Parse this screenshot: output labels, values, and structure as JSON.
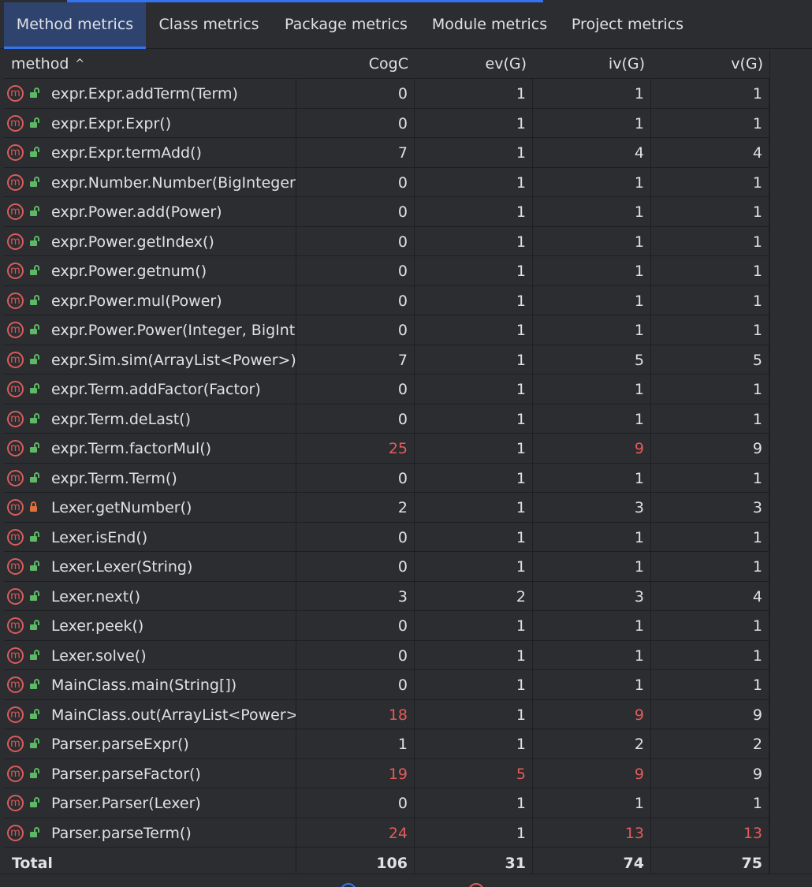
{
  "tabs": [
    {
      "label": "Method metrics",
      "active": true
    },
    {
      "label": "Class metrics",
      "active": false
    },
    {
      "label": "Package metrics",
      "active": false
    },
    {
      "label": "Module metrics",
      "active": false
    },
    {
      "label": "Project metrics",
      "active": false
    }
  ],
  "table": {
    "columns": {
      "method": "method",
      "cogc": "CogC",
      "ev": "ev(G)",
      "iv": "iv(G)",
      "v": "v(G)"
    },
    "sort_glyph": "^",
    "rows": [
      {
        "method": "expr.Expr.addTerm(Term)",
        "access": "public",
        "cogc": "0",
        "ev": "1",
        "iv": "1",
        "v": "1"
      },
      {
        "method": "expr.Expr.Expr()",
        "access": "public",
        "cogc": "0",
        "ev": "1",
        "iv": "1",
        "v": "1"
      },
      {
        "method": "expr.Expr.termAdd()",
        "access": "public",
        "cogc": "7",
        "ev": "1",
        "iv": "4",
        "v": "4"
      },
      {
        "method": "expr.Number.Number(BigInteger)",
        "access": "public",
        "cogc": "0",
        "ev": "1",
        "iv": "1",
        "v": "1"
      },
      {
        "method": "expr.Power.add(Power)",
        "access": "public",
        "cogc": "0",
        "ev": "1",
        "iv": "1",
        "v": "1"
      },
      {
        "method": "expr.Power.getIndex()",
        "access": "public",
        "cogc": "0",
        "ev": "1",
        "iv": "1",
        "v": "1"
      },
      {
        "method": "expr.Power.getnum()",
        "access": "public",
        "cogc": "0",
        "ev": "1",
        "iv": "1",
        "v": "1"
      },
      {
        "method": "expr.Power.mul(Power)",
        "access": "public",
        "cogc": "0",
        "ev": "1",
        "iv": "1",
        "v": "1"
      },
      {
        "method": "expr.Power.Power(Integer, BigInteger)",
        "access": "public",
        "cogc": "0",
        "ev": "1",
        "iv": "1",
        "v": "1"
      },
      {
        "method": "expr.Sim.sim(ArrayList<Power>)",
        "access": "public",
        "cogc": "7",
        "ev": "1",
        "iv": "5",
        "v": "5"
      },
      {
        "method": "expr.Term.addFactor(Factor)",
        "access": "public",
        "cogc": "0",
        "ev": "1",
        "iv": "1",
        "v": "1"
      },
      {
        "method": "expr.Term.deLast()",
        "access": "public",
        "cogc": "0",
        "ev": "1",
        "iv": "1",
        "v": "1"
      },
      {
        "method": "expr.Term.factorMul()",
        "access": "public",
        "cogc": "25",
        "ev": "1",
        "iv": "9",
        "v": "9",
        "warn": [
          "cogc",
          "iv"
        ]
      },
      {
        "method": "expr.Term.Term()",
        "access": "public",
        "cogc": "0",
        "ev": "1",
        "iv": "1",
        "v": "1"
      },
      {
        "method": "Lexer.getNumber()",
        "access": "private",
        "cogc": "2",
        "ev": "1",
        "iv": "3",
        "v": "3"
      },
      {
        "method": "Lexer.isEnd()",
        "access": "public",
        "cogc": "0",
        "ev": "1",
        "iv": "1",
        "v": "1"
      },
      {
        "method": "Lexer.Lexer(String)",
        "access": "public",
        "cogc": "0",
        "ev": "1",
        "iv": "1",
        "v": "1"
      },
      {
        "method": "Lexer.next()",
        "access": "public",
        "cogc": "3",
        "ev": "2",
        "iv": "3",
        "v": "4"
      },
      {
        "method": "Lexer.peek()",
        "access": "public",
        "cogc": "0",
        "ev": "1",
        "iv": "1",
        "v": "1"
      },
      {
        "method": "Lexer.solve()",
        "access": "public",
        "cogc": "0",
        "ev": "1",
        "iv": "1",
        "v": "1"
      },
      {
        "method": "MainClass.main(String[])",
        "access": "public",
        "cogc": "0",
        "ev": "1",
        "iv": "1",
        "v": "1"
      },
      {
        "method": "MainClass.out(ArrayList<Power>)",
        "access": "public",
        "cogc": "18",
        "ev": "1",
        "iv": "9",
        "v": "9",
        "warn": [
          "cogc",
          "iv"
        ]
      },
      {
        "method": "Parser.parseExpr()",
        "access": "public",
        "cogc": "1",
        "ev": "1",
        "iv": "2",
        "v": "2"
      },
      {
        "method": "Parser.parseFactor()",
        "access": "public",
        "cogc": "19",
        "ev": "5",
        "iv": "9",
        "v": "9",
        "warn": [
          "cogc",
          "ev",
          "iv"
        ]
      },
      {
        "method": "Parser.Parser(Lexer)",
        "access": "public",
        "cogc": "0",
        "ev": "1",
        "iv": "1",
        "v": "1"
      },
      {
        "method": "Parser.parseTerm()",
        "access": "public",
        "cogc": "24",
        "ev": "1",
        "iv": "13",
        "v": "13",
        "warn": [
          "cogc",
          "iv",
          "v"
        ]
      }
    ],
    "total": {
      "label": "Total",
      "cogc": "106",
      "ev": "31",
      "iv": "74",
      "v": "75"
    }
  },
  "method_icon_glyph": "m",
  "colors": {
    "accent": "#3574f0",
    "warning": "#e55b5b",
    "public_lock": "#5fb865",
    "private_lock": "#e0703e",
    "method_icon": "#db5c5c"
  }
}
